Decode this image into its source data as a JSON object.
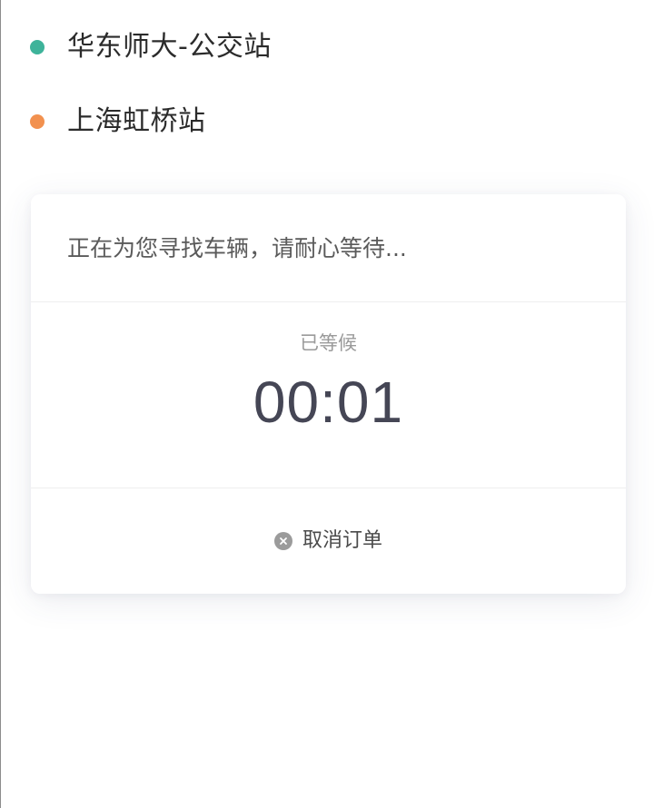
{
  "route": {
    "origin": {
      "label": "华东师大-公交站",
      "dot_color": "#3eb39a"
    },
    "destination": {
      "label": "上海虹桥站",
      "dot_color": "#f2914f"
    }
  },
  "search_card": {
    "status_text": "正在为您寻找车辆，请耐心等待...",
    "waited_label": "已等候",
    "timer": "00:01",
    "cancel_label": "取消订单",
    "cancel_icon": "close-circle-icon",
    "cancel_icon_color": "#9b9b9b"
  }
}
